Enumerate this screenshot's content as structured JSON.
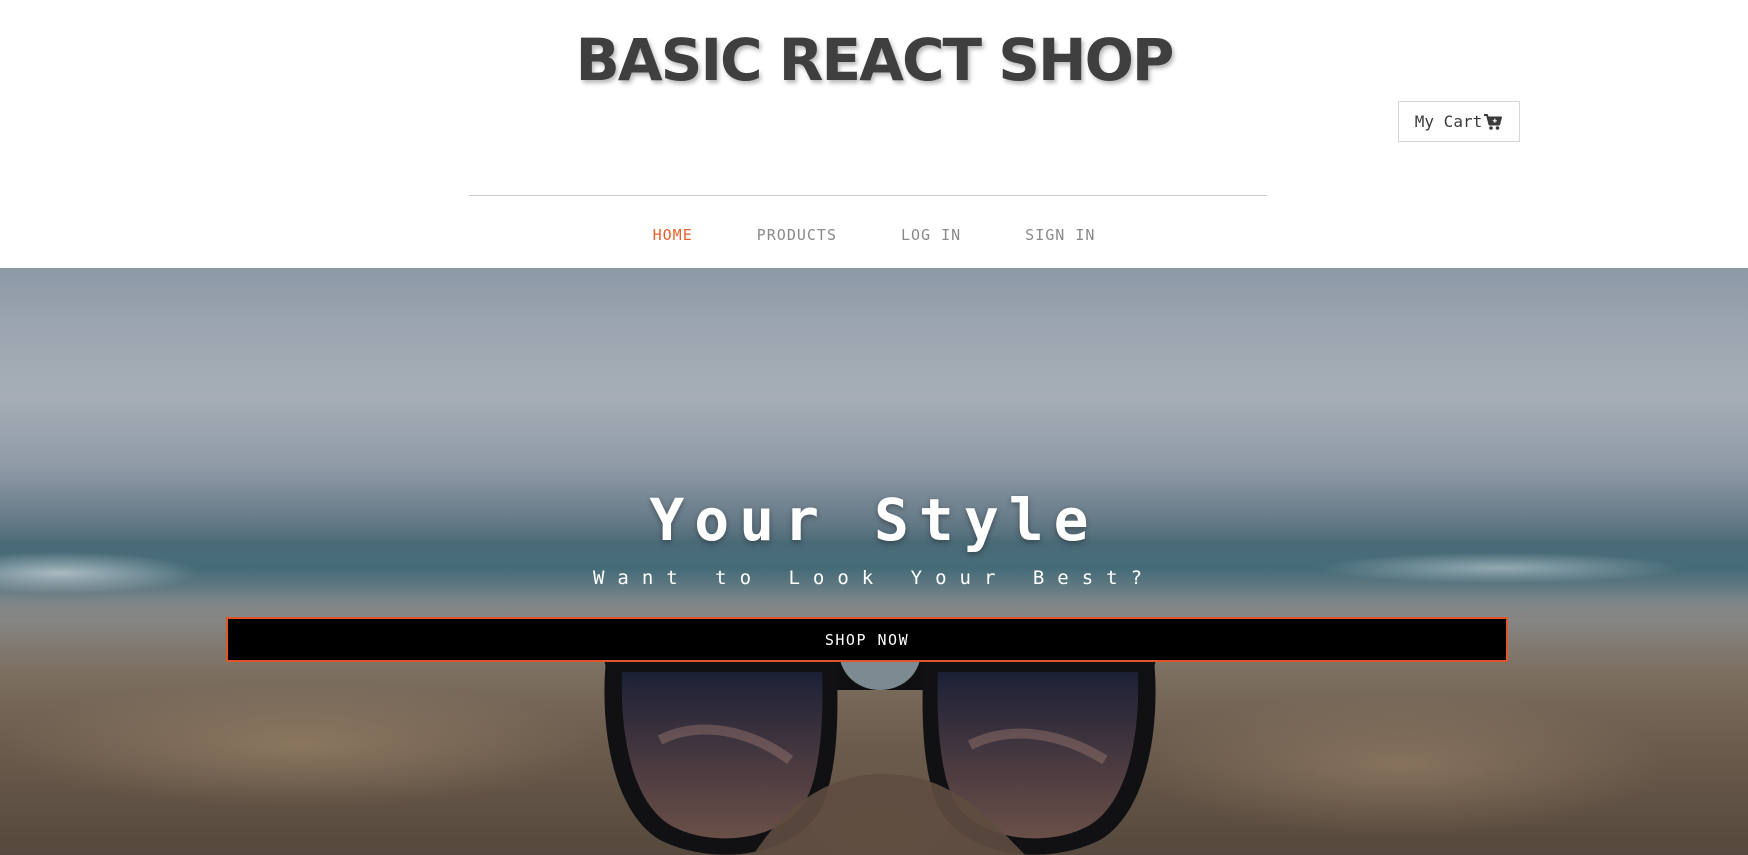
{
  "header": {
    "site_title": "BASIC REACT SHOP",
    "cart_label": "My Cart",
    "cart_icon": "shopping-cart-icon"
  },
  "nav": {
    "items": [
      {
        "label": "HOME",
        "active": true
      },
      {
        "label": "PRODUCTS",
        "active": false
      },
      {
        "label": "LOG IN",
        "active": false
      },
      {
        "label": "SIGN IN",
        "active": false
      }
    ]
  },
  "hero": {
    "title": "Your Style",
    "subtitle": "Want to Look Your Best?",
    "cta_label": "SHOP NOW"
  },
  "colors": {
    "accent": "#e8602c",
    "title_text": "#3f3f3f",
    "nav_text": "#8a8a8a",
    "cta_background": "#000000",
    "cta_border": "#e0552a"
  }
}
